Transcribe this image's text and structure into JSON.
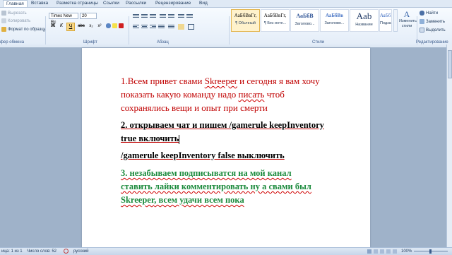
{
  "tabs": [
    "Главная",
    "Вставка",
    "Разметка страницы",
    "Ссылки",
    "Рассылки",
    "Рецензирование",
    "Вид"
  ],
  "clipboard": {
    "cut": "Вырезать",
    "copy": "Копировать",
    "format_painter": "Формат по образцу",
    "label": "фер обмена"
  },
  "font": {
    "name": "Times New Rc",
    "size": "20",
    "bold": "Ж",
    "italic": "К",
    "underline": "Ч",
    "strike": "abc",
    "subscript": "x₂",
    "superscript": "x²",
    "label": "Шрифт"
  },
  "paragraph": {
    "label": "Абзац"
  },
  "styles": {
    "label": "Стили",
    "items": [
      {
        "sample": "АаБбВвГг,",
        "name": "¶ Обычный"
      },
      {
        "sample": "АаБбВвГг,",
        "name": "¶ Без инте..."
      },
      {
        "sample": "АаБбВ",
        "name": "Заголово..."
      },
      {
        "sample": "АаБбВв",
        "name": "Заголово..."
      },
      {
        "sample": "Aab",
        "name": "Название"
      },
      {
        "sample": "АаБбВв",
        "name": "Подзагол..."
      }
    ],
    "change_styles": "Изменить стили"
  },
  "editing": {
    "find": "Найти",
    "replace": "Заменить",
    "select": "Выделить",
    "label": "Редактирование"
  },
  "document": {
    "p1_line1_a": "1.Всем привет свами ",
    "p1_line1_b": "Skreeper",
    "p1_line1_c": " и сегодня я вам хочу",
    "p1_line2_a": "показать какую команду надо ",
    "p1_line2_b": "писать",
    "p1_line2_c": " чтоб",
    "p1_line3": "сохранялись вещи и опыт при смерти",
    "p2_line1": "2. открываем чат и пишем /gamerule keepInventory",
    "p2_line2": "true включить",
    "p3_line1": "/gamerule keepInventory false выключить",
    "p4_line1": "3. незабываем подписыватся на мой канал",
    "p4_line2": "ставить лайки комментировать ну а свами был",
    "p4_line3_a": "Skreeper",
    "p4_line3_b": ", всем удачи всем пока"
  },
  "status": {
    "page": "ица: 1 из 1",
    "words": "Число слов: 52",
    "language": "русский",
    "zoom": "100%"
  }
}
